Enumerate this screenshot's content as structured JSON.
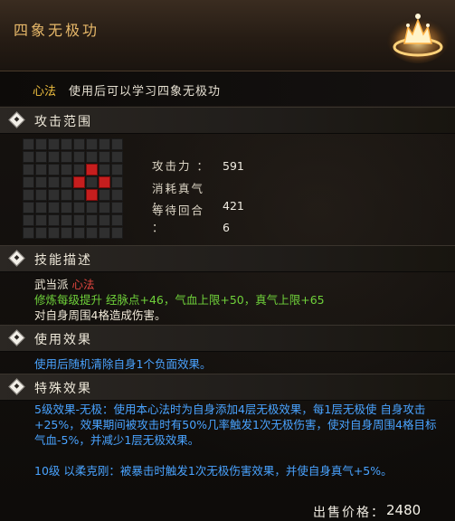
{
  "header": {
    "title": "四象无极功",
    "emblem_icon": "glowing-golden-crown-emblem-icon"
  },
  "subtitle": {
    "type": "心法",
    "description": "使用后可以学习四象无极功"
  },
  "attack_range": {
    "label": "攻击范围",
    "grid_size": [
      8,
      8
    ],
    "highlighted_cells": [
      [
        5,
        2
      ],
      [
        4,
        3
      ],
      [
        6,
        3
      ],
      [
        5,
        4
      ]
    ],
    "stats": [
      {
        "key": "攻击力 ：",
        "value": "591"
      },
      {
        "key": "消耗真气 ：",
        "value": "421"
      },
      {
        "key": "等待回合 ：",
        "value": "6"
      }
    ]
  },
  "skill_desc": {
    "label": "技能描述",
    "sect_label": "武当派",
    "sect_type": "心法",
    "growth": "修炼每级提升 经脉点+46，气血上限+50，真气上限+65",
    "effect": "对自身周围4格造成伤害。"
  },
  "use_effect": {
    "label": "使用效果",
    "text": "使用后随机清除自身1个负面效果。"
  },
  "special_effect": {
    "label": "特殊效果",
    "paragraph1": "5级效果-无极：使用本心法时为自身添加4层无极效果，每1层无极使 自身攻击+25%，效果期间被攻击时有50%几率触发1次无极伤害，使对自身周围4格目标气血-5%，并减少1层无极效果。",
    "paragraph2": "10级 以柔克刚：被暴击时触发1次无极伤害效果，并使自身真气+5%。"
  },
  "price": {
    "label": "出售价格：",
    "value": "2480"
  },
  "colors": {
    "title": "#e8b96a",
    "type": "#f0c040",
    "red": "#e0453f",
    "green": "#6fd13a",
    "blue": "#4aa3ff"
  }
}
